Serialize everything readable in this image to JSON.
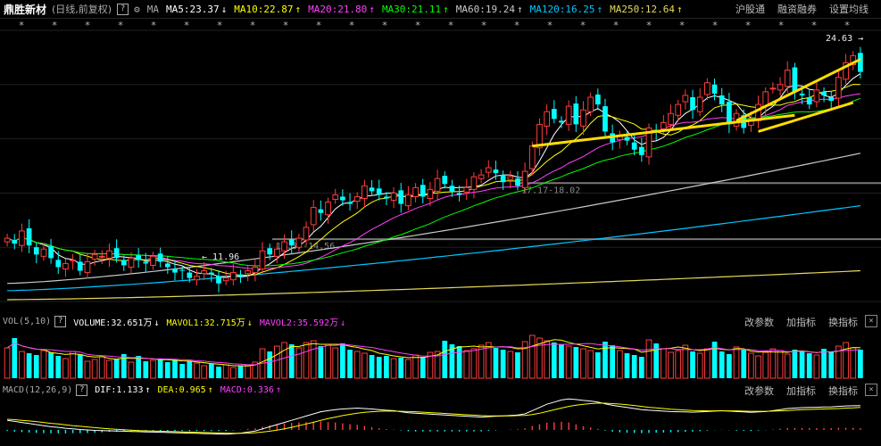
{
  "header": {
    "title": "鼎胜新材",
    "subtitle": "(日线,前复权)",
    "help": "?",
    "ma_prefix": "MA",
    "ma": [
      {
        "label": "MA5:23.37",
        "arrow": "↓",
        "color": "#ffffff"
      },
      {
        "label": "MA10:22.87",
        "arrow": "↑",
        "color": "#ffff00"
      },
      {
        "label": "MA20:21.80",
        "arrow": "↑",
        "color": "#ff40ff"
      },
      {
        "label": "MA30:21.11",
        "arrow": "↑",
        "color": "#00ff00"
      },
      {
        "label": "MA60:19.24",
        "arrow": "↑",
        "color": "#c8c8c8"
      },
      {
        "label": "MA120:16.25",
        "arrow": "↑",
        "color": "#00c8ff"
      },
      {
        "label": "MA250:12.64",
        "arrow": "↑",
        "color": "#e6d85a"
      }
    ],
    "buttons": [
      "沪股通",
      "融资融券",
      "设置均线"
    ]
  },
  "price_panel": {
    "high_label": "24.63",
    "low_label": "11.96",
    "level1_label": "17.17-18.02",
    "level2_label": "14.37-14.56",
    "ylim": [
      11,
      26
    ]
  },
  "vol_panel": {
    "name": "VOL(5,10)",
    "help": "?",
    "volume": {
      "label": "VOLUME:32.651万",
      "arrow": "↓",
      "color": "#ffffff"
    },
    "mavol1": {
      "label": "MAVOL1:32.715万",
      "arrow": "↓",
      "color": "#ffff00"
    },
    "mavol2": {
      "label": "MAVOL2:35.592万",
      "arrow": "↓",
      "color": "#ff40ff"
    },
    "buttons": [
      "改参数",
      "加指标",
      "换指标"
    ],
    "close": "×"
  },
  "macd_panel": {
    "name": "MACD(12,26,9)",
    "help": "?",
    "dif": {
      "label": "DIF:1.133",
      "arrow": "↑",
      "color": "#ffffff"
    },
    "dea": {
      "label": "DEA:0.965",
      "arrow": "↑",
      "color": "#ffff00"
    },
    "macd": {
      "label": "MACD:0.336",
      "arrow": "↑",
      "color": "#ff40ff"
    },
    "buttons": [
      "改参数",
      "加指标",
      "换指标"
    ],
    "close": "×"
  },
  "colors": {
    "up": "#ff3c3c",
    "down": "#00ffff",
    "support": "#ffdd00",
    "grid": "#202020"
  },
  "chart_data": {
    "type": "candlestick",
    "closes": [
      14.5,
      14.2,
      14.9,
      14.1,
      13.6,
      13.9,
      13.4,
      12.9,
      13.1,
      13.3,
      12.7,
      13.2,
      13.6,
      13.5,
      13.8,
      13.4,
      13.0,
      13.4,
      13.3,
      13.1,
      13.5,
      13.2,
      12.9,
      12.6,
      12.7,
      12.3,
      12.4,
      12.7,
      12.5,
      12.0,
      12.3,
      12.6,
      12.4,
      12.7,
      12.9,
      13.8,
      13.6,
      13.9,
      14.3,
      14.1,
      14.5,
      15.1,
      16.2,
      15.9,
      16.5,
      16.9,
      16.6,
      16.4,
      16.8,
      17.4,
      17.1,
      16.9,
      16.7,
      17.0,
      16.4,
      16.9,
      17.3,
      16.8,
      17.2,
      17.8,
      17.5,
      17.1,
      16.9,
      17.3,
      17.9,
      18.0,
      18.4,
      18.1,
      17.6,
      17.9,
      17.4,
      18.2,
      19.6,
      20.8,
      21.5,
      21.1,
      20.9,
      21.8,
      20.8,
      21.6,
      22.3,
      21.9,
      20.4,
      19.8,
      20.2,
      19.9,
      19.4,
      19.1,
      20.6,
      20.4,
      20.9,
      21.4,
      21.9,
      22.4,
      21.6,
      22.3,
      23.1,
      22.5,
      21.9,
      20.8,
      21.4,
      20.6,
      21.1,
      21.9,
      22.6,
      22.8,
      23.0,
      23.8,
      22.6,
      22.4,
      21.9,
      22.7,
      22.4,
      22.1,
      23.4,
      24.2,
      24.6,
      23.7
    ],
    "volumes": [
      34,
      45,
      30,
      28,
      26,
      31,
      29,
      25,
      22,
      30,
      27,
      19,
      21,
      24,
      20,
      22,
      27,
      18,
      25,
      19,
      20,
      22,
      18,
      21,
      16,
      19,
      17,
      14,
      16,
      13,
      15,
      12,
      14,
      15,
      18,
      33,
      30,
      36,
      40,
      38,
      34,
      40,
      42,
      36,
      38,
      34,
      39,
      32,
      30,
      28,
      26,
      24,
      25,
      22,
      23,
      21,
      26,
      24,
      29,
      30,
      42,
      38,
      36,
      31,
      33,
      37,
      40,
      34,
      32,
      30,
      29,
      41,
      48,
      45,
      42,
      40,
      38,
      36,
      35,
      33,
      31,
      29,
      41,
      37,
      31,
      28,
      26,
      24,
      43,
      39,
      33,
      29,
      31,
      37,
      30,
      28,
      33,
      41,
      30,
      27,
      35,
      32,
      28,
      25,
      29,
      33,
      31,
      27,
      32,
      30,
      28,
      26,
      33,
      29,
      36,
      40,
      34,
      32
    ],
    "dif": [
      0.45,
      0.4,
      0.35,
      0.3,
      0.25,
      0.2,
      0.15,
      0.12,
      0.08,
      0.05,
      0.02,
      0.0,
      -0.02,
      -0.03,
      -0.04,
      -0.05,
      -0.06,
      -0.07,
      -0.08,
      -0.09,
      -0.1,
      -0.11,
      -0.12,
      -0.13,
      -0.14,
      -0.15,
      -0.16,
      -0.17,
      -0.18,
      -0.19,
      -0.2,
      -0.18,
      -0.15,
      -0.1,
      -0.05,
      0.05,
      0.15,
      0.25,
      0.35,
      0.45,
      0.55,
      0.65,
      0.75,
      0.85,
      0.9,
      0.95,
      0.98,
      1.0,
      1.02,
      1.0,
      0.98,
      0.95,
      0.92,
      0.9,
      0.85,
      0.8,
      0.78,
      0.76,
      0.74,
      0.72,
      0.7,
      0.68,
      0.66,
      0.64,
      0.62,
      0.6,
      0.62,
      0.64,
      0.66,
      0.68,
      0.7,
      0.75,
      0.9,
      1.05,
      1.2,
      1.3,
      1.4,
      1.45,
      1.42,
      1.38,
      1.35,
      1.3,
      1.22,
      1.15,
      1.1,
      1.05,
      1.0,
      0.95,
      0.92,
      0.9,
      0.88,
      0.86,
      0.85,
      0.84,
      0.83,
      0.84,
      0.86,
      0.88,
      0.9,
      0.88,
      0.86,
      0.84,
      0.82,
      0.84,
      0.86,
      0.9,
      0.95,
      1.0,
      1.02,
      1.04,
      1.05,
      1.06,
      1.07,
      1.08,
      1.1,
      1.12,
      1.13,
      1.133
    ],
    "dea": [
      0.5,
      0.48,
      0.45,
      0.42,
      0.39,
      0.35,
      0.31,
      0.28,
      0.24,
      0.2,
      0.17,
      0.14,
      0.11,
      0.08,
      0.05,
      0.03,
      0.01,
      -0.01,
      -0.03,
      -0.04,
      -0.05,
      -0.06,
      -0.07,
      -0.08,
      -0.09,
      -0.1,
      -0.11,
      -0.12,
      -0.13,
      -0.14,
      -0.15,
      -0.16,
      -0.16,
      -0.15,
      -0.13,
      -0.1,
      -0.06,
      -0.01,
      0.05,
      0.12,
      0.2,
      0.28,
      0.36,
      0.45,
      0.53,
      0.6,
      0.67,
      0.73,
      0.78,
      0.82,
      0.85,
      0.87,
      0.88,
      0.88,
      0.87,
      0.86,
      0.85,
      0.83,
      0.81,
      0.79,
      0.77,
      0.75,
      0.73,
      0.71,
      0.69,
      0.67,
      0.66,
      0.66,
      0.66,
      0.66,
      0.67,
      0.68,
      0.72,
      0.78,
      0.86,
      0.94,
      1.02,
      1.1,
      1.16,
      1.2,
      1.23,
      1.25,
      1.25,
      1.23,
      1.21,
      1.18,
      1.14,
      1.1,
      1.06,
      1.03,
      1.0,
      0.97,
      0.95,
      0.93,
      0.91,
      0.9,
      0.89,
      0.89,
      0.89,
      0.89,
      0.89,
      0.88,
      0.87,
      0.87,
      0.87,
      0.88,
      0.89,
      0.91,
      0.93,
      0.95,
      0.96,
      0.97,
      0.98,
      0.99,
      1.0,
      1.02,
      1.03,
      1.05
    ]
  }
}
